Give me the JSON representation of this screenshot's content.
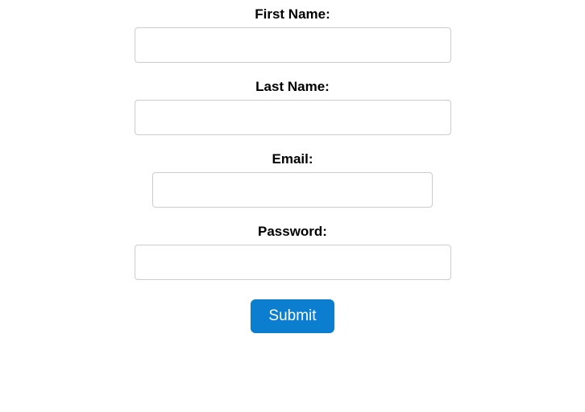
{
  "form": {
    "fields": {
      "first_name": {
        "label": "First Name:",
        "value": ""
      },
      "last_name": {
        "label": "Last Name:",
        "value": ""
      },
      "email": {
        "label": "Email:",
        "value": ""
      },
      "password": {
        "label": "Password:",
        "value": ""
      }
    },
    "submit_label": "Submit"
  }
}
